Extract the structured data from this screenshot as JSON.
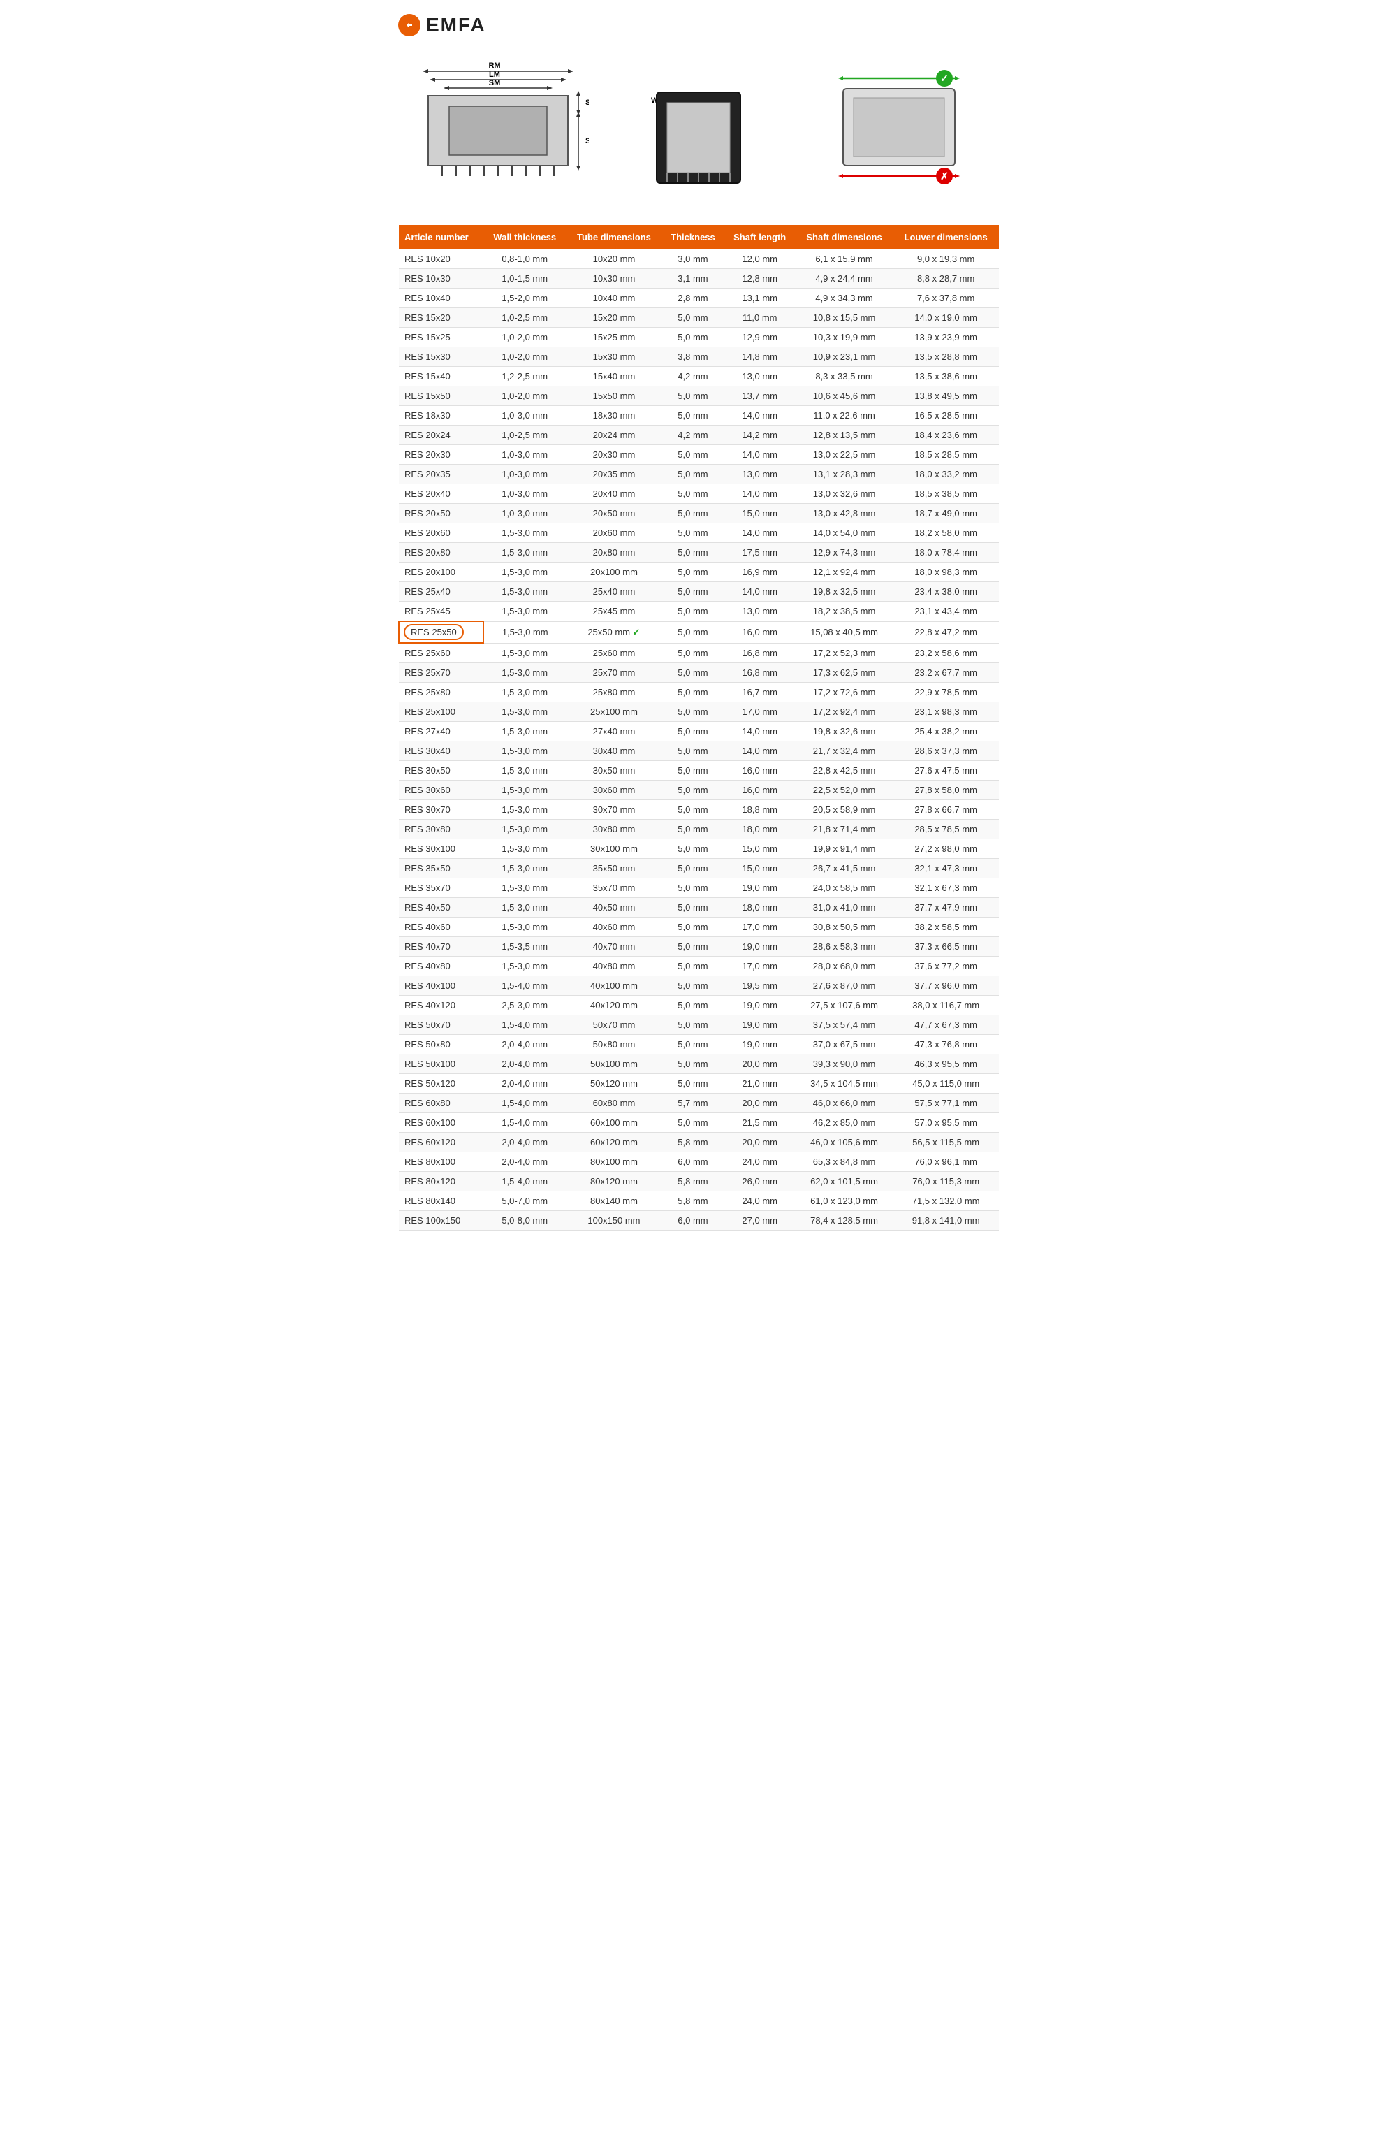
{
  "logo": {
    "symbol": "●",
    "text": "EMFA"
  },
  "diagrams": {
    "diagram1": {
      "labels": [
        "RM",
        "LM",
        "SM",
        "SK",
        "SE"
      ]
    },
    "diagram2": {
      "labels": [
        "WS"
      ]
    },
    "diagram3": {
      "check": "✓",
      "cross": "✗"
    }
  },
  "table": {
    "headers": [
      "Article number",
      "Wall thickness",
      "Tube dimensions",
      "Thickness",
      "Shaft length",
      "Shaft dimensions",
      "Louver dimensions"
    ],
    "rows": [
      [
        "RES 10x20",
        "0,8-1,0 mm",
        "10x20 mm",
        "3,0 mm",
        "12,0 mm",
        "6,1 x 15,9 mm",
        "9,0 x 19,3 mm"
      ],
      [
        "RES 10x30",
        "1,0-1,5 mm",
        "10x30 mm",
        "3,1 mm",
        "12,8 mm",
        "4,9 x 24,4 mm",
        "8,8 x 28,7 mm"
      ],
      [
        "RES 10x40",
        "1,5-2,0 mm",
        "10x40 mm",
        "2,8 mm",
        "13,1 mm",
        "4,9 x 34,3 mm",
        "7,6 x 37,8 mm"
      ],
      [
        "RES 15x20",
        "1,0-2,5 mm",
        "15x20 mm",
        "5,0 mm",
        "11,0 mm",
        "10,8 x 15,5 mm",
        "14,0 x 19,0 mm"
      ],
      [
        "RES 15x25",
        "1,0-2,0 mm",
        "15x25 mm",
        "5,0 mm",
        "12,9 mm",
        "10,3 x 19,9 mm",
        "13,9 x 23,9 mm"
      ],
      [
        "RES 15x30",
        "1,0-2,0 mm",
        "15x30 mm",
        "3,8 mm",
        "14,8 mm",
        "10,9 x 23,1 mm",
        "13,5 x 28,8 mm"
      ],
      [
        "RES 15x40",
        "1,2-2,5 mm",
        "15x40 mm",
        "4,2 mm",
        "13,0 mm",
        "8,3 x 33,5 mm",
        "13,5 x 38,6 mm"
      ],
      [
        "RES 15x50",
        "1,0-2,0 mm",
        "15x50 mm",
        "5,0 mm",
        "13,7 mm",
        "10,6 x 45,6 mm",
        "13,8 x 49,5 mm"
      ],
      [
        "RES 18x30",
        "1,0-3,0 mm",
        "18x30 mm",
        "5,0 mm",
        "14,0 mm",
        "11,0 x 22,6 mm",
        "16,5 x 28,5 mm"
      ],
      [
        "RES 20x24",
        "1,0-2,5 mm",
        "20x24 mm",
        "4,2 mm",
        "14,2 mm",
        "12,8 x 13,5 mm",
        "18,4 x 23,6 mm"
      ],
      [
        "RES 20x30",
        "1,0-3,0 mm",
        "20x30 mm",
        "5,0 mm",
        "14,0 mm",
        "13,0 x 22,5 mm",
        "18,5 x 28,5 mm"
      ],
      [
        "RES 20x35",
        "1,0-3,0 mm",
        "20x35 mm",
        "5,0 mm",
        "13,0 mm",
        "13,1 x 28,3 mm",
        "18,0 x 33,2 mm"
      ],
      [
        "RES 20x40",
        "1,0-3,0 mm",
        "20x40 mm",
        "5,0 mm",
        "14,0 mm",
        "13,0 x 32,6 mm",
        "18,5 x 38,5 mm"
      ],
      [
        "RES 20x50",
        "1,0-3,0 mm",
        "20x50 mm",
        "5,0 mm",
        "15,0 mm",
        "13,0 x 42,8 mm",
        "18,7 x 49,0 mm"
      ],
      [
        "RES 20x60",
        "1,5-3,0 mm",
        "20x60 mm",
        "5,0 mm",
        "14,0 mm",
        "14,0 x 54,0 mm",
        "18,2 x 58,0 mm"
      ],
      [
        "RES 20x80",
        "1,5-3,0 mm",
        "20x80 mm",
        "5,0 mm",
        "17,5 mm",
        "12,9 x 74,3 mm",
        "18,0 x 78,4 mm"
      ],
      [
        "RES 20x100",
        "1,5-3,0 mm",
        "20x100 mm",
        "5,0 mm",
        "16,9 mm",
        "12,1 x 92,4 mm",
        "18,0 x 98,3 mm"
      ],
      [
        "RES 25x40",
        "1,5-3,0 mm",
        "25x40 mm",
        "5,0 mm",
        "14,0 mm",
        "19,8 x 32,5 mm",
        "23,4 x 38,0 mm"
      ],
      [
        "RES 25x45",
        "1,5-3,0 mm",
        "25x45 mm",
        "5,0 mm",
        "13,0 mm",
        "18,2 x 38,5 mm",
        "23,1 x 43,4 mm"
      ],
      [
        "RES 25x50",
        "1,5-3,0 mm",
        "25x50 mm",
        "5,0 mm",
        "16,0 mm",
        "15,08 x 40,5 mm",
        "22,8 x 47,2 mm",
        "highlighted"
      ],
      [
        "RES 25x60",
        "1,5-3,0 mm",
        "25x60 mm",
        "5,0 mm",
        "16,8 mm",
        "17,2 x 52,3 mm",
        "23,2 x 58,6 mm"
      ],
      [
        "RES 25x70",
        "1,5-3,0 mm",
        "25x70 mm",
        "5,0 mm",
        "16,8 mm",
        "17,3 x 62,5 mm",
        "23,2 x 67,7 mm"
      ],
      [
        "RES 25x80",
        "1,5-3,0 mm",
        "25x80 mm",
        "5,0 mm",
        "16,7 mm",
        "17,2 x 72,6 mm",
        "22,9 x 78,5 mm"
      ],
      [
        "RES 25x100",
        "1,5-3,0 mm",
        "25x100 mm",
        "5,0 mm",
        "17,0 mm",
        "17,2 x 92,4 mm",
        "23,1 x 98,3 mm"
      ],
      [
        "RES 27x40",
        "1,5-3,0 mm",
        "27x40 mm",
        "5,0 mm",
        "14,0 mm",
        "19,8 x 32,6 mm",
        "25,4 x 38,2 mm"
      ],
      [
        "RES 30x40",
        "1,5-3,0 mm",
        "30x40 mm",
        "5,0 mm",
        "14,0 mm",
        "21,7 x 32,4 mm",
        "28,6 x 37,3 mm"
      ],
      [
        "RES 30x50",
        "1,5-3,0 mm",
        "30x50 mm",
        "5,0 mm",
        "16,0 mm",
        "22,8 x 42,5 mm",
        "27,6 x 47,5 mm"
      ],
      [
        "RES 30x60",
        "1,5-3,0 mm",
        "30x60 mm",
        "5,0 mm",
        "16,0 mm",
        "22,5 x 52,0 mm",
        "27,8 x 58,0 mm"
      ],
      [
        "RES 30x70",
        "1,5-3,0 mm",
        "30x70 mm",
        "5,0 mm",
        "18,8 mm",
        "20,5 x 58,9 mm",
        "27,8 x 66,7 mm"
      ],
      [
        "RES 30x80",
        "1,5-3,0 mm",
        "30x80 mm",
        "5,0 mm",
        "18,0 mm",
        "21,8 x 71,4 mm",
        "28,5 x 78,5 mm"
      ],
      [
        "RES 30x100",
        "1,5-3,0 mm",
        "30x100 mm",
        "5,0 mm",
        "15,0 mm",
        "19,9 x 91,4 mm",
        "27,2 x 98,0 mm"
      ],
      [
        "RES 35x50",
        "1,5-3,0 mm",
        "35x50 mm",
        "5,0 mm",
        "15,0 mm",
        "26,7 x 41,5 mm",
        "32,1 x 47,3 mm"
      ],
      [
        "RES 35x70",
        "1,5-3,0 mm",
        "35x70 mm",
        "5,0 mm",
        "19,0 mm",
        "24,0 x 58,5 mm",
        "32,1 x 67,3 mm"
      ],
      [
        "RES 40x50",
        "1,5-3,0 mm",
        "40x50 mm",
        "5,0 mm",
        "18,0 mm",
        "31,0 x 41,0 mm",
        "37,7 x 47,9 mm"
      ],
      [
        "RES 40x60",
        "1,5-3,0 mm",
        "40x60 mm",
        "5,0 mm",
        "17,0 mm",
        "30,8 x 50,5 mm",
        "38,2 x 58,5 mm"
      ],
      [
        "RES 40x70",
        "1,5-3,5 mm",
        "40x70 mm",
        "5,0 mm",
        "19,0 mm",
        "28,6 x 58,3 mm",
        "37,3 x 66,5 mm"
      ],
      [
        "RES 40x80",
        "1,5-3,0 mm",
        "40x80 mm",
        "5,0 mm",
        "17,0 mm",
        "28,0 x 68,0 mm",
        "37,6 x 77,2 mm"
      ],
      [
        "RES 40x100",
        "1,5-4,0 mm",
        "40x100 mm",
        "5,0 mm",
        "19,5 mm",
        "27,6 x 87,0 mm",
        "37,7 x 96,0 mm"
      ],
      [
        "RES 40x120",
        "2,5-3,0 mm",
        "40x120 mm",
        "5,0 mm",
        "19,0 mm",
        "27,5 x 107,6 mm",
        "38,0 x 116,7 mm"
      ],
      [
        "RES 50x70",
        "1,5-4,0 mm",
        "50x70 mm",
        "5,0 mm",
        "19,0 mm",
        "37,5 x 57,4 mm",
        "47,7 x 67,3 mm"
      ],
      [
        "RES 50x80",
        "2,0-4,0 mm",
        "50x80 mm",
        "5,0 mm",
        "19,0 mm",
        "37,0 x 67,5 mm",
        "47,3 x 76,8 mm"
      ],
      [
        "RES 50x100",
        "2,0-4,0 mm",
        "50x100 mm",
        "5,0 mm",
        "20,0 mm",
        "39,3 x 90,0 mm",
        "46,3 x 95,5 mm"
      ],
      [
        "RES 50x120",
        "2,0-4,0 mm",
        "50x120 mm",
        "5,0 mm",
        "21,0 mm",
        "34,5 x 104,5 mm",
        "45,0 x 115,0 mm"
      ],
      [
        "RES 60x80",
        "1,5-4,0 mm",
        "60x80 mm",
        "5,7 mm",
        "20,0 mm",
        "46,0 x 66,0 mm",
        "57,5 x 77,1 mm"
      ],
      [
        "RES 60x100",
        "1,5-4,0 mm",
        "60x100 mm",
        "5,0 mm",
        "21,5 mm",
        "46,2 x 85,0 mm",
        "57,0 x 95,5 mm"
      ],
      [
        "RES 60x120",
        "2,0-4,0 mm",
        "60x120 mm",
        "5,8 mm",
        "20,0 mm",
        "46,0 x 105,6 mm",
        "56,5 x 115,5 mm"
      ],
      [
        "RES 80x100",
        "2,0-4,0 mm",
        "80x100 mm",
        "6,0 mm",
        "24,0 mm",
        "65,3 x 84,8 mm",
        "76,0 x 96,1 mm"
      ],
      [
        "RES 80x120",
        "1,5-4,0 mm",
        "80x120 mm",
        "5,8 mm",
        "26,0 mm",
        "62,0 x 101,5 mm",
        "76,0 x 115,3 mm"
      ],
      [
        "RES 80x140",
        "5,0-7,0 mm",
        "80x140 mm",
        "5,8 mm",
        "24,0 mm",
        "61,0 x 123,0 mm",
        "71,5 x 132,0 mm"
      ],
      [
        "RES 100x150",
        "5,0-8,0 mm",
        "100x150 mm",
        "6,0 mm",
        "27,0 mm",
        "78,4 x 128,5 mm",
        "91,8 x 141,0 mm"
      ]
    ]
  }
}
